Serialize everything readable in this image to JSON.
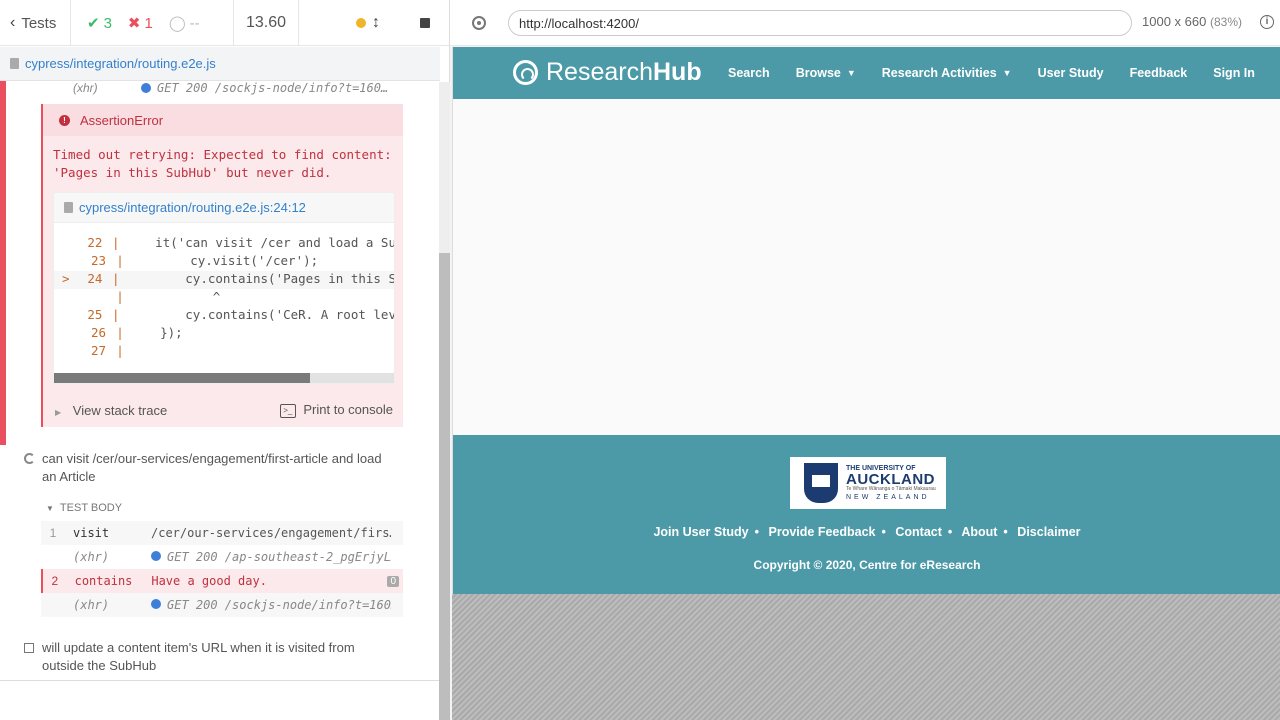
{
  "topbar": {
    "tests_label": "Tests",
    "passed": "3",
    "failed": "1",
    "pending": "--",
    "duration": "13.60"
  },
  "spec": {
    "path": "cypress/integration/routing.e2e.js"
  },
  "log_top": {
    "tag": "(xhr)",
    "message": "GET 200 /sockjs-node/info?t=160…"
  },
  "error": {
    "title": "AssertionError",
    "message_line1": "Timed out retrying: Expected to find content:",
    "message_line2": "'Pages in this SubHub' but never did.",
    "file": "cypress/integration/routing.e2e.js:24:12",
    "code": [
      {
        "ln": "22",
        "prefix": "",
        "text": "    it('can visit /cer and load a Su"
      },
      {
        "ln": "23",
        "prefix": "",
        "text": "        cy.visit('/cer');"
      },
      {
        "ln": "24",
        "prefix": "> ",
        "text": "        cy.contains('Pages in this S"
      },
      {
        "ln": "",
        "prefix": "",
        "text": "           ^"
      },
      {
        "ln": "25",
        "prefix": "",
        "text": "        cy.contains('CeR. A root lev"
      },
      {
        "ln": "26",
        "prefix": "",
        "text": "    });"
      },
      {
        "ln": "27",
        "prefix": "",
        "text": ""
      }
    ],
    "stack_label": "View stack trace",
    "console_label": "Print to console"
  },
  "test2": {
    "title_line1": "can visit /cer/our-services/engagement/first-article and load",
    "title_line2": "an Article",
    "body_label": "TEST BODY",
    "commands": [
      {
        "n": "1",
        "name": "visit",
        "msg": "/cer/our-services/engagement/firs…"
      },
      {
        "n": "",
        "name": "(xhr)",
        "msg": "GET 200 /ap-southeast-2_pgErjyL…"
      },
      {
        "n": "2",
        "name": "contains",
        "msg": "Have a good day.",
        "badge": "0"
      },
      {
        "n": "",
        "name": "(xhr)",
        "msg": "GET 200 /sockjs-node/info?t=160…"
      }
    ]
  },
  "test3": {
    "title_line1": "will update a content item's URL when it is visited from",
    "title_line2": "outside the SubHub"
  },
  "aut": {
    "url": "http://localhost:4200/",
    "viewport": "1000 x 660",
    "scale": "(83%)"
  },
  "site": {
    "logo_light": "Research",
    "logo_bold": "Hub",
    "nav": [
      "Search",
      "Browse",
      "Research Activities",
      "User Study",
      "Feedback",
      "Sign In"
    ],
    "university": {
      "line1": "THE UNIVERSITY OF",
      "line2": "AUCKLAND",
      "line3": "Te Whare Wānanga o Tāmaki Makaurau",
      "line4": "NEW ZEALAND"
    },
    "footer_links": [
      "Join User Study",
      "Provide Feedback",
      "Contact",
      "About",
      "Disclaimer"
    ],
    "copyright": "Copyright © 2020, Centre for eResearch"
  }
}
